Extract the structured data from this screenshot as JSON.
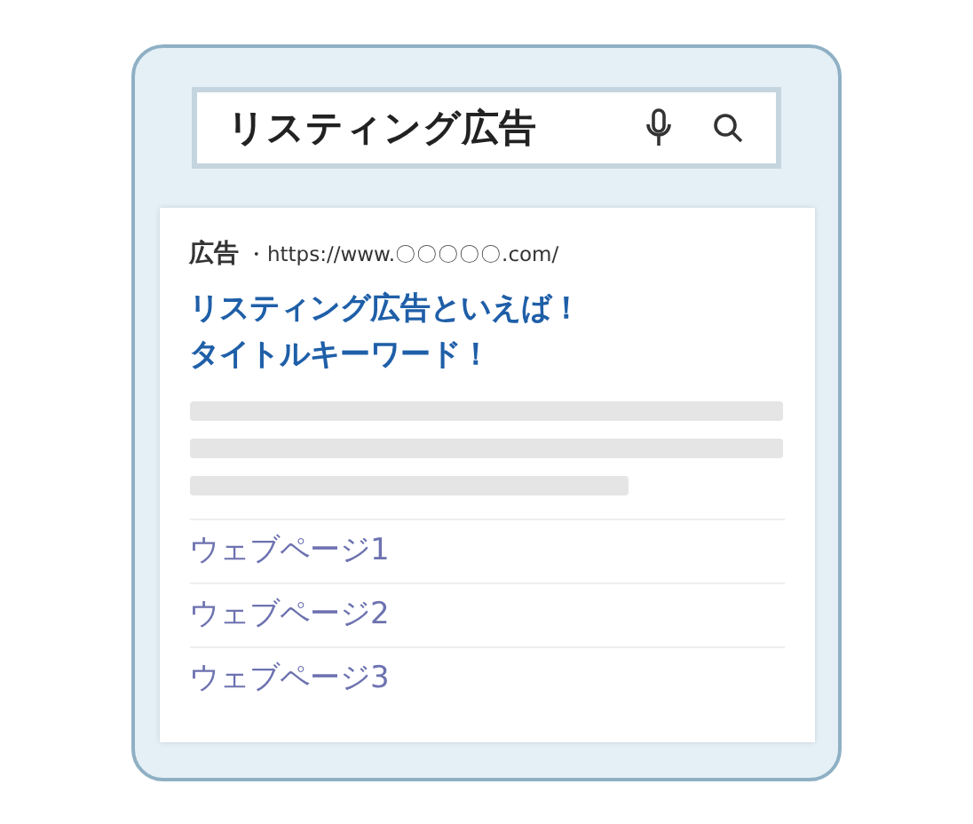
{
  "search": {
    "value": "リスティング広告"
  },
  "ad": {
    "label": "広告",
    "url": "・https://www.〇〇〇〇〇.com/",
    "title_lines": [
      "リスティング広告といえば！",
      "タイトルキーワード！"
    ],
    "sitelinks": [
      "ウェブページ1",
      "ウェブページ2",
      "ウェブページ3"
    ]
  }
}
